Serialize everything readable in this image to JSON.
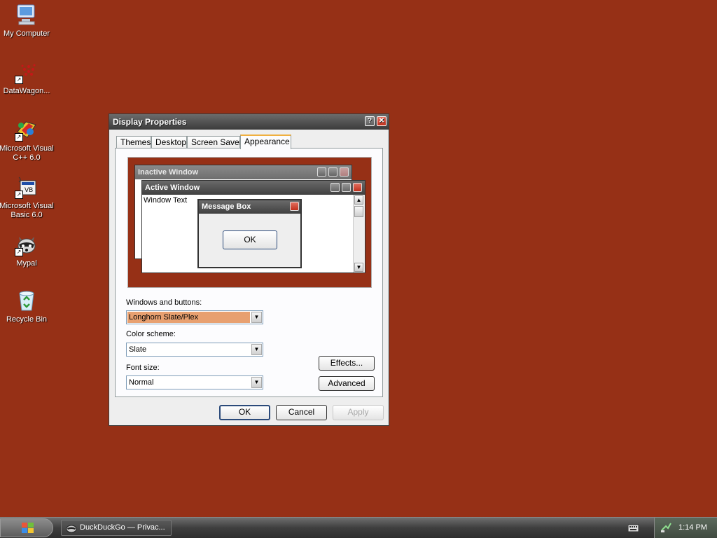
{
  "desktop": {
    "background_color": "#963016",
    "icons": [
      {
        "label": "My Computer",
        "icon": "computer-icon"
      },
      {
        "label": "DataWagon...",
        "icon": "datawagon-icon"
      },
      {
        "label": "Microsoft Visual C++ 6.0",
        "icon": "visual-cpp-icon"
      },
      {
        "label": "Microsoft Visual Basic 6.0",
        "icon": "visual-basic-icon"
      },
      {
        "label": "Mypal",
        "icon": "raccoon-icon"
      },
      {
        "label": "Recycle Bin",
        "icon": "recycle-bin-icon"
      }
    ]
  },
  "dialog": {
    "title": "Display Properties",
    "tabs": [
      "Themes",
      "Desktop",
      "Screen Saver",
      "Appearance"
    ],
    "active_tab": "Appearance",
    "preview": {
      "inactive_title": "Inactive Window",
      "active_title": "Active Window",
      "window_text": "Window Text",
      "msgbox_title": "Message Box",
      "msgbox_ok": "OK"
    },
    "windows_buttons": {
      "label": "Windows and buttons:",
      "value": "Longhorn Slate/Plex"
    },
    "color_scheme": {
      "label": "Color scheme:",
      "value": "Slate"
    },
    "font_size": {
      "label": "Font size:",
      "value": "Normal"
    },
    "effects_button": "Effects...",
    "advanced_button": "Advanced",
    "ok_button": "OK",
    "cancel_button": "Cancel",
    "apply_button": "Apply"
  },
  "taskbar": {
    "task_label": "DuckDuckGo — Privac...",
    "clock": "1:14 PM"
  }
}
